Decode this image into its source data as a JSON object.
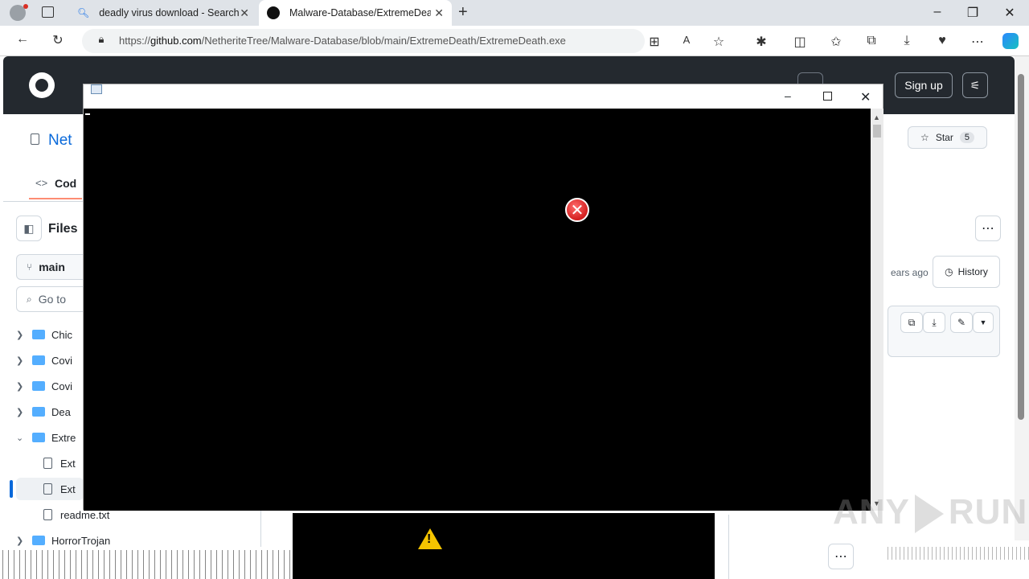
{
  "tabs": [
    {
      "title": "deadly virus download - Search",
      "icon": "search-icon"
    },
    {
      "title": "Malware-Database/ExtremeDeath/",
      "icon": "github-icon"
    }
  ],
  "browser": {
    "url_prefix": "https://",
    "url_host": "github.com",
    "url_path": "/NetheriteTree/Malware-Database/blob/main/ExtremeDeath/ExtremeDeath.exe"
  },
  "github": {
    "signup": "Sign up",
    "repo_fragment": "Net",
    "code_tab": "Cod",
    "files_label": "Files",
    "branch": "main",
    "go_to_file": "Go to",
    "star_label": "Star",
    "star_count": "5",
    "last_commit": "ears ago",
    "history_label": "History",
    "tree": [
      {
        "label": "Chic",
        "kind": "folder"
      },
      {
        "label": "Covi",
        "kind": "folder"
      },
      {
        "label": "Covi",
        "kind": "folder"
      },
      {
        "label": "Dea",
        "kind": "folder"
      },
      {
        "label": "Extre",
        "kind": "folder-open"
      },
      {
        "label": "Ext",
        "kind": "file"
      },
      {
        "label": "Ext",
        "kind": "file"
      },
      {
        "label": "readme.txt",
        "kind": "file"
      },
      {
        "label": "HorrorTrojan",
        "kind": "folder"
      }
    ]
  },
  "watermark": {
    "text_left": "ANY",
    "text_right": "RUN"
  },
  "colors": {
    "accent_blue": "#0969da",
    "header_dark": "#24292f",
    "error_red": "#c00000",
    "warning_yellow": "#f5c400"
  }
}
